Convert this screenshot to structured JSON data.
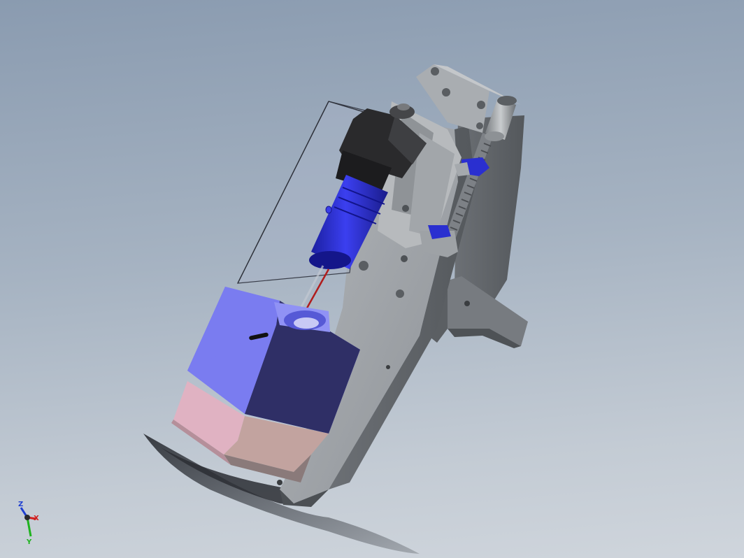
{
  "viewport": {
    "background_top": "#8a9bb0",
    "background_bottom": "#cfd5dc"
  },
  "model": {
    "parts": [
      "mounting-base-plate",
      "support-bracket",
      "slide-rail-block",
      "lead-screw",
      "adjustment-knob",
      "clamp-nut-upper",
      "clamp-nut-lower",
      "motor-housing",
      "motor-coupling",
      "transparent-tube",
      "red-needle",
      "blue-cube-chamber",
      "pink-cube-base"
    ],
    "colors": {
      "steel": "#9a9ea3",
      "steel_dark": "#5f6468",
      "motor_black": "#2a2a2c",
      "coupling_blue": "#2a2fd0",
      "cube_blue": "#7a7cf0",
      "cube_blue_dark": "#2f2f66",
      "cube_pink": "#e0b2c2",
      "needle_red": "#b01c1c"
    }
  },
  "triad": {
    "x_label": "X",
    "y_label": "Y",
    "z_label": "Z",
    "x_color": "#d11f1f",
    "y_color": "#1fb31f",
    "z_color": "#1f3fd1"
  }
}
